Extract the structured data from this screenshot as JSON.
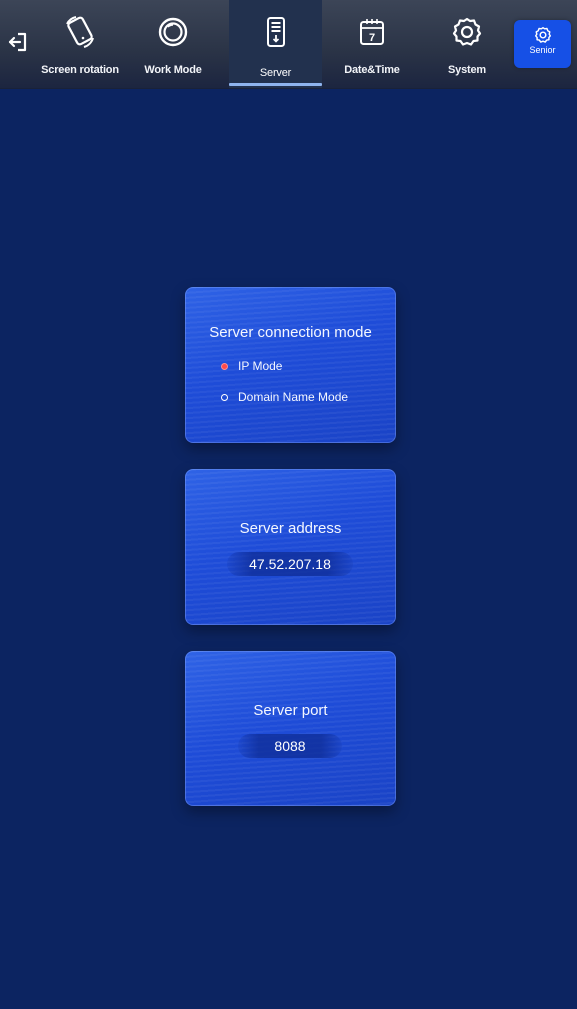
{
  "nav": {
    "tabs": [
      {
        "label": "Screen rotation",
        "icon": "rotation-icon"
      },
      {
        "label": "Work Mode",
        "icon": "work-mode-icon"
      },
      {
        "label": "Server",
        "icon": "server-icon",
        "active": true
      },
      {
        "label": "Date&Time",
        "icon": "calendar-icon",
        "calendar_day": "7"
      },
      {
        "label": "System",
        "icon": "gear-icon"
      }
    ],
    "senior": {
      "label": "Senior",
      "icon": "gear-icon"
    },
    "back_icon": "exit-icon"
  },
  "connection_mode": {
    "title": "Server connection mode",
    "options": [
      {
        "label": "IP Mode",
        "selected": true
      },
      {
        "label": "Domain Name Mode",
        "selected": false
      }
    ]
  },
  "server_address": {
    "title": "Server address",
    "value": "47.52.207.18"
  },
  "server_port": {
    "title": "Server port",
    "value": "8088"
  },
  "colors": {
    "background": "#0c2461",
    "card": "#2356e0",
    "accent": "#1650e6",
    "active_underline": "#8fb4ee",
    "radio_selected": "#ff4a4a"
  }
}
